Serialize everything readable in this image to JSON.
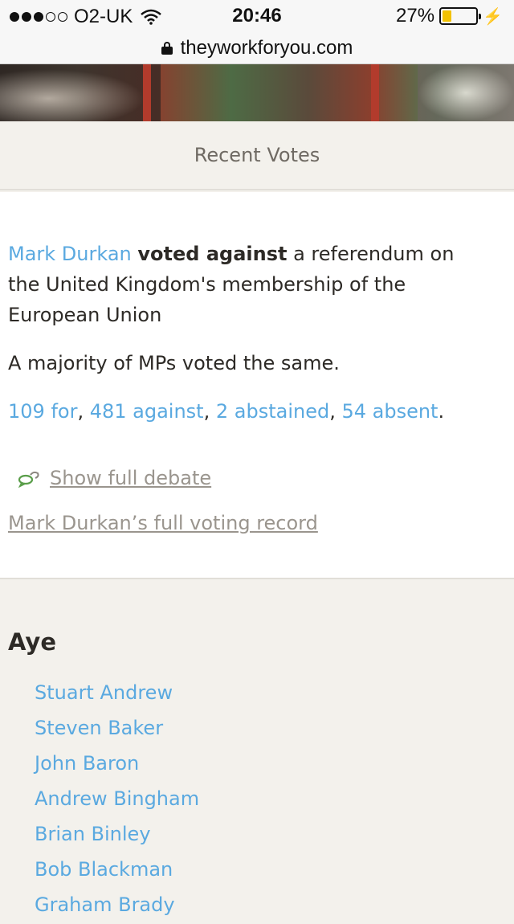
{
  "status": {
    "signal_dots": 5,
    "signal_filled": 3,
    "carrier": "O2-UK",
    "time": "20:46",
    "battery_percent": "27%",
    "battery_level": 0.27,
    "icons": [
      "wifi-icon",
      "battery-icon",
      "charging-bolt-icon"
    ]
  },
  "browser": {
    "url": "theyworkforyou.com"
  },
  "section": {
    "title": "Recent Votes"
  },
  "vote": {
    "member_name": "Mark Durkan",
    "verdict": "voted against",
    "motion": " a referendum on the United Kingdom's membership of the European Union",
    "majority_note": "A majority of MPs voted the same.",
    "tally": {
      "for": "109 for",
      "against": "481 against",
      "abstained": "2 abstained",
      "absent": "54 absent",
      "sep": ", ",
      "end": "."
    },
    "show_debate": "Show full debate",
    "voting_record": "Mark Durkan’s full voting record"
  },
  "aye": {
    "heading": "Aye",
    "members": [
      "Stuart Andrew",
      "Steven Baker",
      "John Baron",
      "Andrew Bingham",
      "Brian Binley",
      "Bob Blackman",
      "Graham Brady"
    ]
  },
  "colors": {
    "link": "#5aa9e0",
    "text": "#2d2a26",
    "muted": "#9a958e",
    "background": "#f3f1ec",
    "debate_icon": "#5a9e4a",
    "battery_fill": "#f2c200"
  }
}
